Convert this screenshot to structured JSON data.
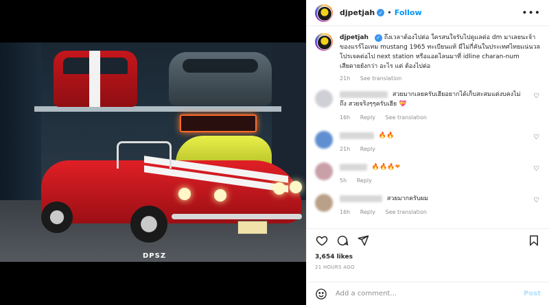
{
  "post": {
    "watermark": "DPSZ"
  },
  "header": {
    "username": "djpetjah",
    "separator": "•",
    "follow_label": "Follow",
    "more_icon": "more-horizontal-icon"
  },
  "caption": {
    "username": "djpetjah",
    "text": "ถึงเวลาต้องไปต่อ ใครสนใจรับไปดูแลต่อ dm มาเลยนะจ้า ของแรร์ไอเทม mustang 1965 ทะเบียนแท้ มีไม่กี่คันในประเทศไทยแน่นวล โปรเจคต่อไป next station หรือแอดไลนมาที่ idline charan-num เสียดายยังกว่า อะไร แต่ ต้องไปต่อ",
    "time": "21h",
    "see_translation": "See translation"
  },
  "comments": [
    {
      "text": "สวยมากเลยครับเฮียอยากได้เก็บสะสมแต่งบคงไม่ถึง สวยจริงๆๆครับเฮีย",
      "emoji": "💝",
      "time": "16h",
      "reply": "Reply",
      "see_translation": "See translation",
      "avatar_color": "#cfcfd6"
    },
    {
      "text": "",
      "emoji": "🔥🔥",
      "time": "21h",
      "reply": "Reply",
      "see_translation": "",
      "avatar_color": "#5f8fd0"
    },
    {
      "text": "",
      "emoji": "🔥🔥🔥❤",
      "time": "5h",
      "reply": "Reply",
      "see_translation": "",
      "avatar_color": "#c9a0a8"
    },
    {
      "text": "สวยมากครับผม",
      "emoji": "",
      "time": "16h",
      "reply": "Reply",
      "see_translation": "See translation",
      "avatar_color": "#b9a089"
    }
  ],
  "footer": {
    "likes": "3,654 likes",
    "time": "21 HOURS AGO",
    "add_comment_placeholder": "Add a comment...",
    "post_label": "Post"
  },
  "colors": {
    "accent": "#0095f6",
    "post_disabled": "#b2dffc",
    "muted": "#8e8e8e"
  }
}
